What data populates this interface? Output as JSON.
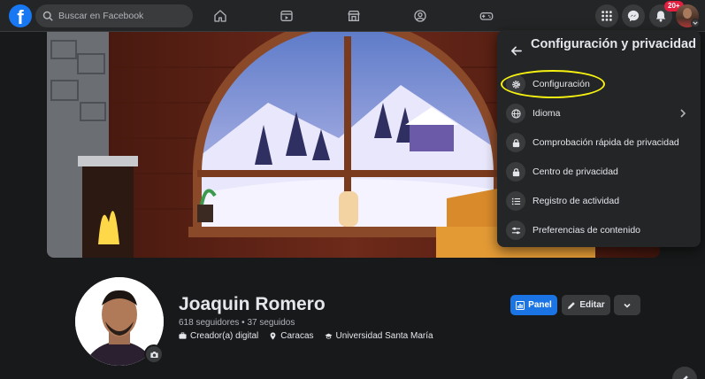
{
  "topbar": {
    "logo": "f",
    "search_placeholder": "Buscar en Facebook",
    "nav_icons": [
      "home-icon",
      "video-icon",
      "marketplace-icon",
      "groups-icon",
      "gaming-icon"
    ],
    "right_icons": [
      "menu-grid-icon",
      "messenger-icon",
      "bell-icon"
    ],
    "notification_badge": "20+"
  },
  "profile": {
    "name": "Joaquin Romero",
    "followers": "618 seguidores • 37 seguidos",
    "meta": {
      "role": "Creador(a) digital",
      "city": "Caracas",
      "school": "Universidad Santa María"
    },
    "buttons": {
      "panel": "Panel",
      "edit": "Editar"
    }
  },
  "dropdown": {
    "title": "Configuración y privacidad",
    "items": [
      {
        "label": "Configuración",
        "icon": "gear-icon"
      },
      {
        "label": "Idioma",
        "icon": "globe-icon",
        "has_submenu": true
      },
      {
        "label": "Comprobación rápida de privacidad",
        "icon": "lock-icon"
      },
      {
        "label": "Centro de privacidad",
        "icon": "lock-icon"
      },
      {
        "label": "Registro de actividad",
        "icon": "list-icon"
      },
      {
        "label": "Preferencias de contenido",
        "icon": "sliders-icon"
      }
    ],
    "highlighted_item": "Configuración"
  },
  "colors": {
    "accent": "#1b74e4",
    "background": "#18191a",
    "surface": "#242526",
    "highlight_ring": "#f5f111",
    "badge": "#e41e3f"
  }
}
